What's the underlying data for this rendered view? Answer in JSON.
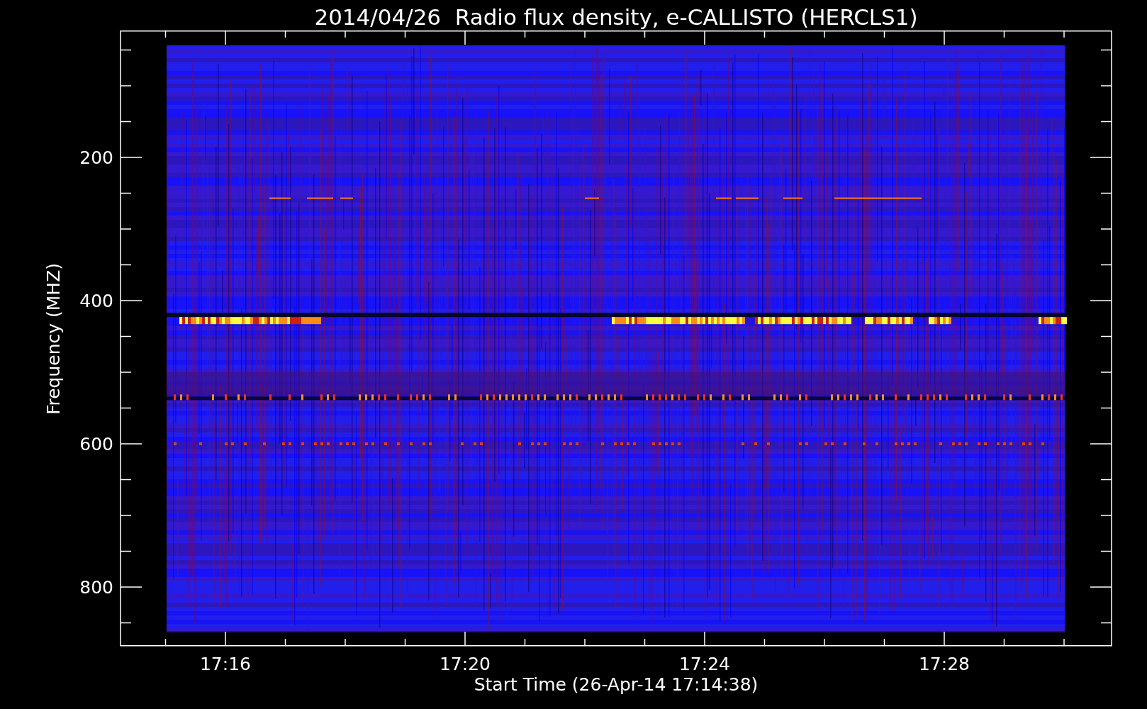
{
  "title": "2014/04/26  Radio flux density, e-CALLISTO (HERCLS1)",
  "plot": {
    "y_label": "Frequency (MHZ)",
    "x_label": "Start Time (26-Apr-14 17:14:38)",
    "y_ticks": [
      "200",
      "400",
      "600",
      "800"
    ],
    "x_ticks": [
      "17:16",
      "17:20",
      "17:24",
      "17:28"
    ]
  }
}
